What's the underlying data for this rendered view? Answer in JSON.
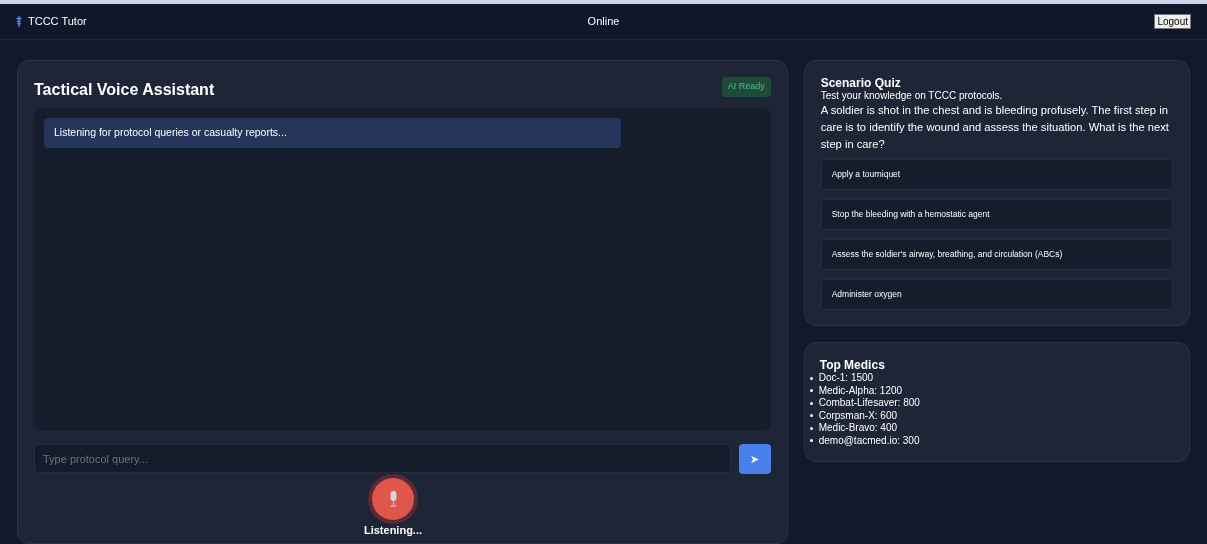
{
  "header": {
    "brand": "TCCC Tutor",
    "status": "Online",
    "logout": "Logout"
  },
  "assistant": {
    "title": "Tactical Voice Assistant",
    "badge": "AI Ready",
    "messages": [
      "Listening for protocol queries or casualty reports..."
    ],
    "input": {
      "placeholder": "Type protocol query..."
    },
    "send": "➤",
    "mic_label": "Listening..."
  },
  "quiz": {
    "title": "Scenario Quiz",
    "subtitle": "Test your knowledge on TCCC protocols.",
    "question": "A soldier is shot in the chest and is bleeding profusely. The first step in care is to identify the wound and assess the situation. What is the next step in care?",
    "options": [
      "Apply a tourniquet",
      "Stop the bleeding with a hemostatic agent",
      "Assess the soldier's airway, breathing, and circulation (ABCs)",
      "Administer oxygen"
    ]
  },
  "leaderboard": {
    "title": "Top Medics",
    "entries": [
      "Doc-1: 1500",
      "Medic-Alpha: 1200",
      "Combat-Lifesaver: 800",
      "Corpsman-X: 600",
      "Medic-Bravo: 400",
      "demo@tacmed.io: 300"
    ]
  }
}
